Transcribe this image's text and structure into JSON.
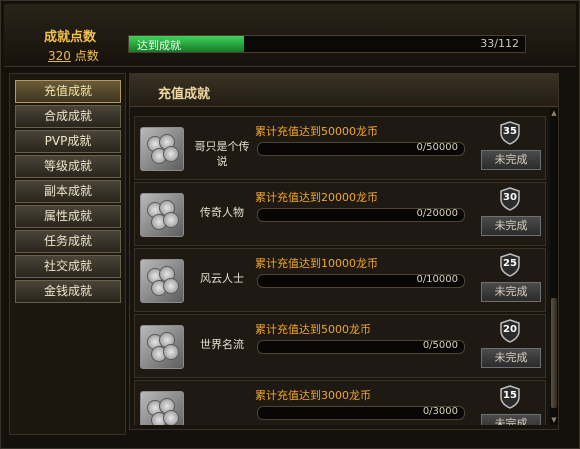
{
  "header": {
    "title": "成就点数",
    "points_value": "320",
    "points_label": "点数",
    "progress_label": "达到成就",
    "progress_count": "33/112",
    "progress_fraction": 0.29
  },
  "sidebar": {
    "items": [
      {
        "label": "充值成就",
        "active": true
      },
      {
        "label": "合成成就"
      },
      {
        "label": "PVP成就"
      },
      {
        "label": "等级成就"
      },
      {
        "label": "副本成就"
      },
      {
        "label": "属性成就"
      },
      {
        "label": "任务成就"
      },
      {
        "label": "社交成就"
      },
      {
        "label": "金钱成就"
      }
    ]
  },
  "main": {
    "title": "充值成就",
    "rows": [
      {
        "name": "哥只是个传说",
        "desc": "累计充值达到50000龙币",
        "progress": "0/50000",
        "points": "35",
        "button": "未完成"
      },
      {
        "name": "传奇人物",
        "desc": "累计充值达到20000龙币",
        "progress": "0/20000",
        "points": "30",
        "button": "未完成"
      },
      {
        "name": "风云人士",
        "desc": "累计充值达到10000龙币",
        "progress": "0/10000",
        "points": "25",
        "button": "未完成"
      },
      {
        "name": "世界名流",
        "desc": "累计充值达到5000龙币",
        "progress": "0/5000",
        "points": "20",
        "button": "未完成"
      },
      {
        "name": "",
        "desc": "累计充值达到3000龙币",
        "progress": "0/3000",
        "points": "15",
        "button": "未完成"
      }
    ]
  },
  "colors": {
    "accent_gold": "#f2c14e",
    "progress_green": "#3fd25a",
    "desc_orange": "#f0a62a"
  }
}
